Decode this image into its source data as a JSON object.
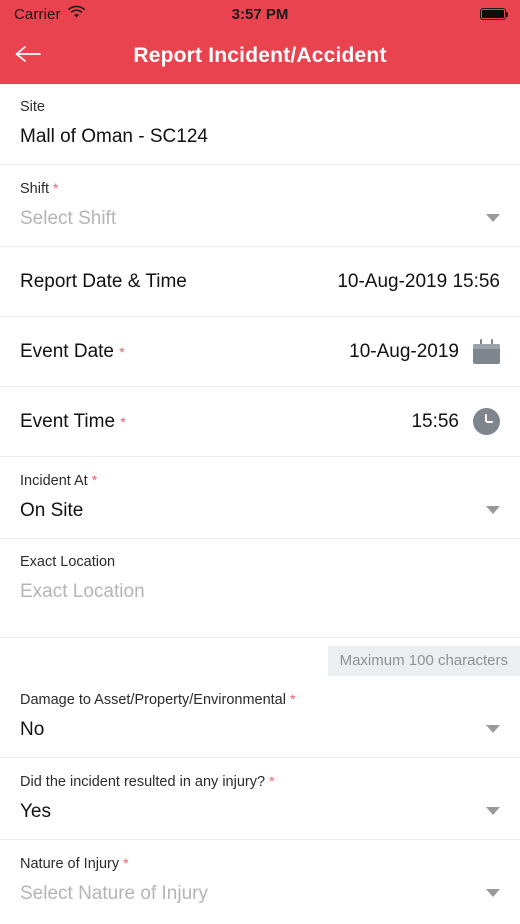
{
  "theme": {
    "brand": "#e8434f",
    "required_marker": "#f1616b",
    "divider": "#ececec",
    "icon_gray": "#7e858d"
  },
  "status_bar": {
    "carrier": "Carrier",
    "wifi_icon": "wifi-icon",
    "time": "3:57 PM",
    "battery_icon": "battery-full-icon"
  },
  "nav": {
    "back_icon": "back-arrow-icon",
    "title": "Report Incident/Accident"
  },
  "form": {
    "site": {
      "label": "Site",
      "value": "Mall of Oman - SC124"
    },
    "shift": {
      "label": "Shift",
      "required": "*",
      "placeholder": "Select Shift",
      "chevron_icon": "chevron-down-icon"
    },
    "report_datetime": {
      "label": "Report Date & Time",
      "value": "10-Aug-2019 15:56"
    },
    "event_date": {
      "label": "Event Date",
      "required": "*",
      "value": "10-Aug-2019",
      "icon": "calendar-icon"
    },
    "event_time": {
      "label": "Event Time",
      "required": "*",
      "value": "15:56",
      "icon": "clock-icon"
    },
    "incident_at": {
      "label": "Incident At",
      "required": "*",
      "value": "On Site",
      "chevron_icon": "chevron-down-icon"
    },
    "exact_location": {
      "label": "Exact Location",
      "placeholder": "Exact Location",
      "hint": "Maximum 100 characters"
    },
    "damage": {
      "label": "Damage to Asset/Property/Environmental",
      "required": "*",
      "value": "No",
      "chevron_icon": "chevron-down-icon"
    },
    "injury": {
      "label": "Did the incident resulted in any injury?",
      "required": "*",
      "value": "Yes",
      "chevron_icon": "chevron-down-icon"
    },
    "nature_of_injury": {
      "label": "Nature of Injury",
      "required": "*",
      "placeholder": "Select Nature of Injury",
      "chevron_icon": "chevron-down-icon"
    }
  }
}
